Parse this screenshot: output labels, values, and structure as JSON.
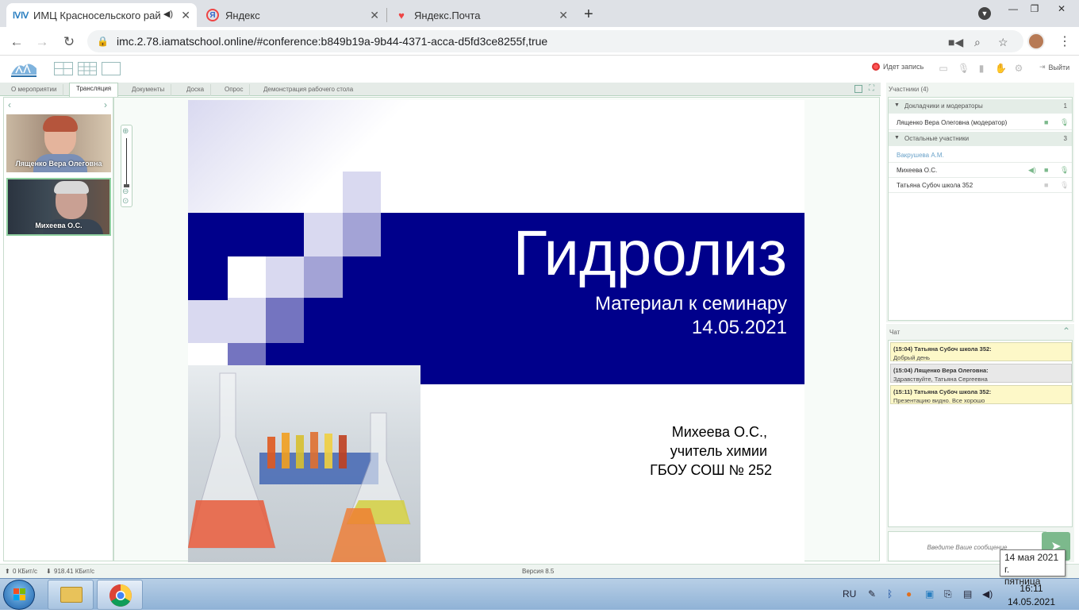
{
  "browser": {
    "tabs": [
      {
        "title": "ИМЦ Красносельского рай",
        "favicon": "imc-logo-icon",
        "active": true
      },
      {
        "title": "Яндекс",
        "favicon": "yandex-icon",
        "active": false
      },
      {
        "title": "Яндекс.Почта",
        "favicon": "yandex-mail-icon",
        "active": false
      }
    ],
    "new_tab": "+",
    "url": "imc.2.78.iamatschool.online/#conference:b849b19a-9b44-4371-acca-d5fd3ce8255f,true"
  },
  "toolbar": {
    "recording_label": "Идет запись",
    "exit_label": "Выйти"
  },
  "tabs": [
    "О мероприятии",
    "Трансляция",
    "Документы",
    "Доска",
    "Опрос",
    "Демонстрация рабочего стола"
  ],
  "active_tab": "Трансляция",
  "videos": [
    {
      "name": "Лященко Вера Олеговна"
    },
    {
      "name": "Михеева О.С."
    }
  ],
  "slide": {
    "title": "Гидролиз",
    "subtitle_line1": "Материал к семинару",
    "subtitle_line2": "14.05.2021",
    "author_line1": "Михеева О.С.,",
    "author_line2": "учитель химии",
    "author_line3": "ГБОУ СОШ № 252",
    "colors": {
      "banner": "#00008b",
      "square_light": "#d9d9f0",
      "square_mid": "#a3a3d6",
      "square_dark": "#7474c0"
    }
  },
  "participants": {
    "header": "Участники (4)",
    "group1": {
      "label": "Докладчики и модераторы",
      "count": "1"
    },
    "moderator": "Лященко Вера Олеговна (модератор)",
    "group2": {
      "label": "Остальные участники",
      "count": "3"
    },
    "others": [
      "Вакрушева А.М.",
      "Михеева О.С.",
      "Татьяна Субоч школа 352"
    ]
  },
  "chat": {
    "header": "Чат",
    "messages": [
      {
        "from": "(15:04) Татьяна Субоч школа 352:",
        "text": "Добрый день",
        "bg": "#fdf8c8"
      },
      {
        "from": "(15:04) Лященко Вера Олеговна:",
        "text": "Здравствуйте, Татьяна Сергеевна",
        "bg": "#e8e8e8"
      },
      {
        "from": "(15:11) Татьяна Субоч школа 352:",
        "text": "Презентацию видно. Все хорошо",
        "bg": "#fdf8c8"
      }
    ],
    "input_placeholder": "Введите Ваше сообщение"
  },
  "status": {
    "upload": "0 КБит/с",
    "download": "918.41 КБит/с",
    "version": "Версия 8.5"
  },
  "taskbar": {
    "language": "RU",
    "time": "16:11",
    "date": "14.05.2021",
    "tooltip_line1": "14 мая 2021 г.",
    "tooltip_line2": "пятница"
  }
}
